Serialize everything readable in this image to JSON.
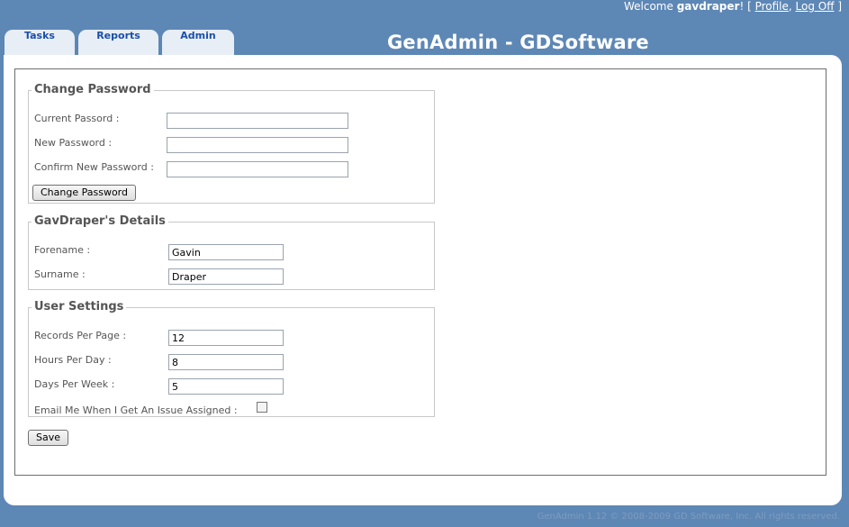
{
  "header": {
    "welcome_prefix": "Welcome ",
    "username": "gavdraper",
    "welcome_suffix": "! [ ",
    "profile_link": "Profile",
    "separator": ", ",
    "logoff_link": "Log Off",
    "close_bracket": " ]",
    "app_title": "GenAdmin - GDSoftware"
  },
  "tabs": [
    {
      "label": "Tasks"
    },
    {
      "label": "Reports"
    },
    {
      "label": "Admin"
    }
  ],
  "change_password": {
    "legend": "Change Password",
    "current_label": "Current Passord :",
    "current_value": "",
    "new_label": "New Password :",
    "new_value": "",
    "confirm_label": "Confirm New Password :",
    "confirm_value": "",
    "button_label": "Change Password"
  },
  "details": {
    "legend": "GavDraper's Details",
    "forename_label": "Forename :",
    "forename_value": "Gavin",
    "surname_label": "Surname :",
    "surname_value": "Draper"
  },
  "settings": {
    "legend": "User Settings",
    "records_label": "Records Per Page :",
    "records_value": "12",
    "hours_label": "Hours Per Day :",
    "hours_value": "8",
    "days_label": "Days Per Week :",
    "days_value": "5",
    "email_label": "Email Me When I Get An Issue Assigned :",
    "email_checked": false
  },
  "save_label": "Save",
  "footer": "GenAdmin 1.12 © 2008-2009 GD Software, Inc. All rights reserved.",
  "colors": {
    "background": "#5d87b5",
    "tab_text": "#1a4fa8",
    "panel": "#ffffff"
  }
}
